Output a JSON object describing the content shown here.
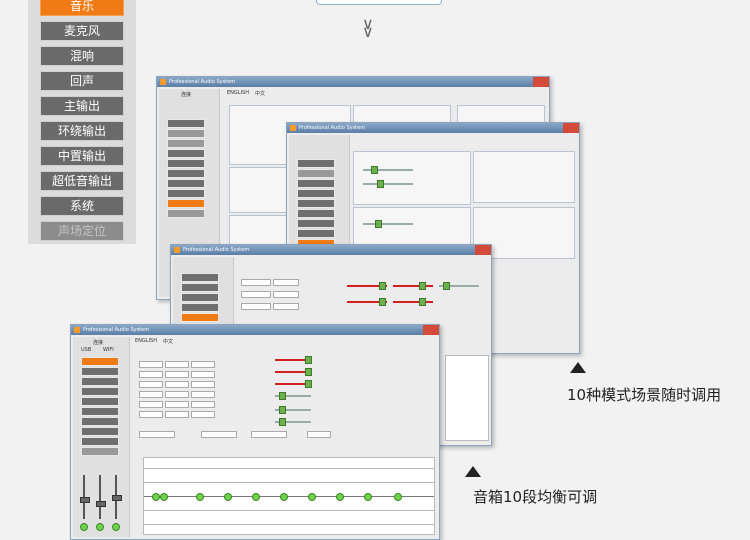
{
  "menu": {
    "items": [
      {
        "label": "音乐",
        "state": "active"
      },
      {
        "label": "麦克风",
        "state": "normal"
      },
      {
        "label": "混响",
        "state": "normal"
      },
      {
        "label": "回声",
        "state": "normal"
      },
      {
        "label": "主输出",
        "state": "normal"
      },
      {
        "label": "环绕输出",
        "state": "normal"
      },
      {
        "label": "中置输出",
        "state": "normal"
      },
      {
        "label": "超低音输出",
        "state": "normal"
      },
      {
        "label": "系统",
        "state": "normal"
      },
      {
        "label": "声场定位",
        "state": "disabled"
      }
    ]
  },
  "icons": {
    "chevron": "chevron-double-down-icon"
  },
  "screens": {
    "title": "Professional Audio System",
    "lang_en": "ENGLISH",
    "lang_zh": "中文",
    "connect": "连接",
    "usb": "USB",
    "wifi": "WIFI",
    "win4_menu": [
      "音乐",
      "麦克风",
      "混响",
      "回声",
      "主输出",
      "环绕输出",
      "中置输出",
      "超低音输出",
      "系统",
      "声场定位"
    ]
  },
  "captions": {
    "modes": "10种模式场景随时调用",
    "eq": "音箱10段均衡可调"
  },
  "colors": {
    "accent": "#f07a14",
    "menu_bg": "#6a6a6a",
    "knob": "#6fd04a"
  }
}
